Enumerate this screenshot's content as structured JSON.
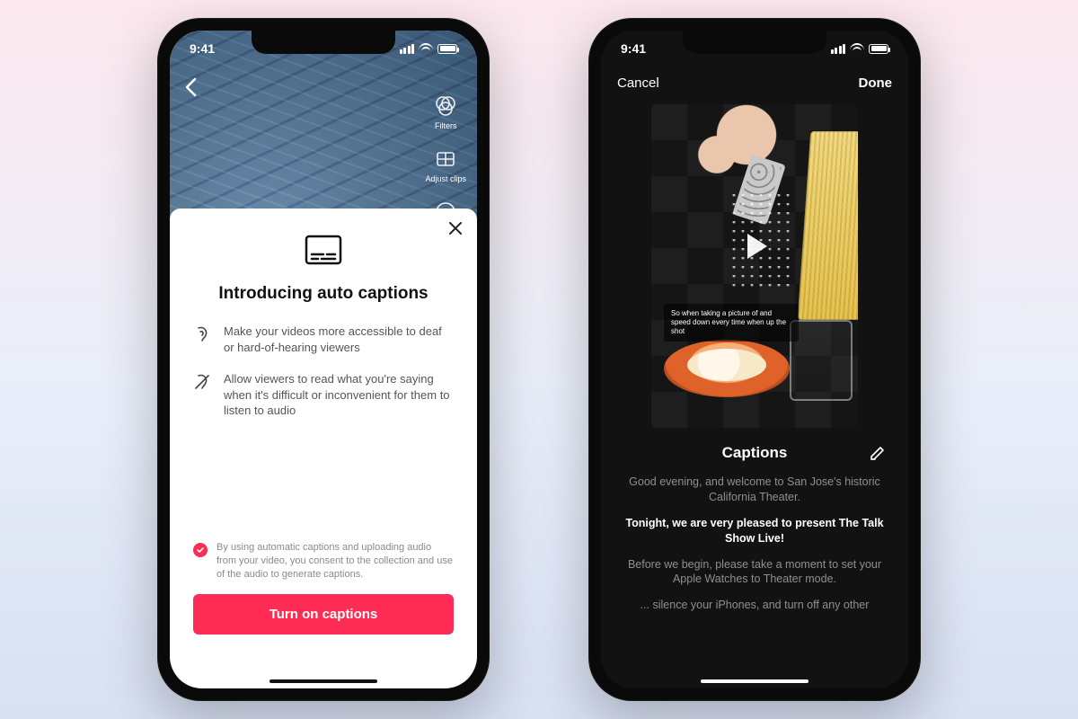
{
  "status": {
    "time": "9:41"
  },
  "left": {
    "side_tools": {
      "filters": "Filters",
      "adjust_clips": "Adjust clips"
    },
    "sheet": {
      "title": "Introducing auto captions",
      "bullet1": "Make your videos more accessible to deaf or hard-of-hearing viewers",
      "bullet2": "Allow viewers to read what you're saying when it's difficult or inconvenient for them to listen to audio",
      "consent": "By using automatic captions and uploading audio from your video, you consent to the collection and use of the audio to generate captions.",
      "cta": "Turn on captions"
    }
  },
  "right": {
    "nav": {
      "cancel": "Cancel",
      "done": "Done"
    },
    "overlay_caption": "So when taking a picture of and speed down every time when up the shot",
    "captions_label": "Captions",
    "lines": {
      "l1": "Good evening, and welcome to San Jose's historic California Theater.",
      "l2": "Tonight, we are very pleased to present The Talk Show Live!",
      "l3": "Before we begin, please take a moment to set your Apple Watches to Theater mode.",
      "l4": "... silence your iPhones, and turn off any other"
    }
  }
}
